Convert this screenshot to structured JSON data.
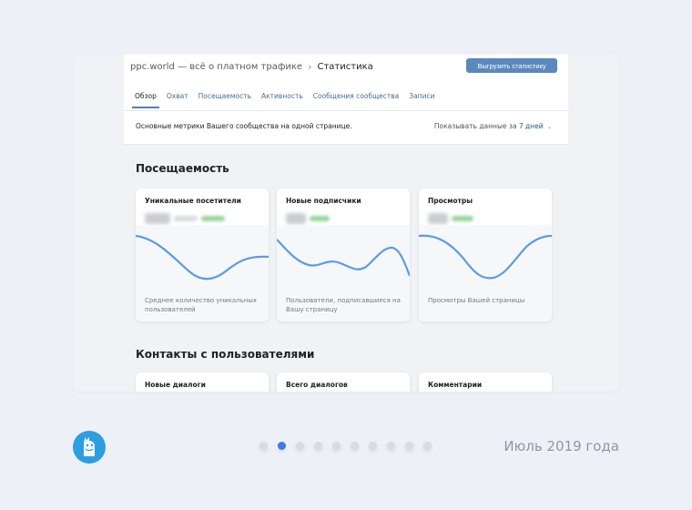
{
  "header": {
    "community": "ppc.world — всё о платном трафике",
    "current": "Статистика",
    "export_button": "Выгрузить статистику"
  },
  "tabs": [
    {
      "label": "Обзор",
      "active": true
    },
    {
      "label": "Охват",
      "active": false
    },
    {
      "label": "Посещаемость",
      "active": false
    },
    {
      "label": "Активность",
      "active": false
    },
    {
      "label": "Сообщения сообщества",
      "active": false
    },
    {
      "label": "Записи",
      "active": false
    }
  ],
  "overview": {
    "description": "Основные метрики Вашего сообщества на одной странице.",
    "period_label": "Показывать данные за",
    "period_value": "7 дней"
  },
  "sections": {
    "attendance_title": "Посещаемость",
    "contacts_title": "Контакты с пользователями"
  },
  "attendance_cards": [
    {
      "title": "Уникальные посетители",
      "description": "Среднее количество уникальных пользователей"
    },
    {
      "title": "Новые подписчики",
      "description": "Пользователи, подписавшиеся на Вашу страницу"
    },
    {
      "title": "Просмотры",
      "description": "Просмотры Вашей страницы"
    }
  ],
  "contacts_cards": [
    {
      "title": "Новые диалоги"
    },
    {
      "title": "Всего диалогов"
    },
    {
      "title": "Комментарии"
    }
  ],
  "footer": {
    "date": "Июль 2019 года",
    "pages_total": 10,
    "active_page": 2
  },
  "colors": {
    "accent": "#5181b8",
    "button": "#5b88bd",
    "line": "#5b9be6",
    "logo": "#2d9fe0",
    "dot_active": "#3b7ddd"
  }
}
